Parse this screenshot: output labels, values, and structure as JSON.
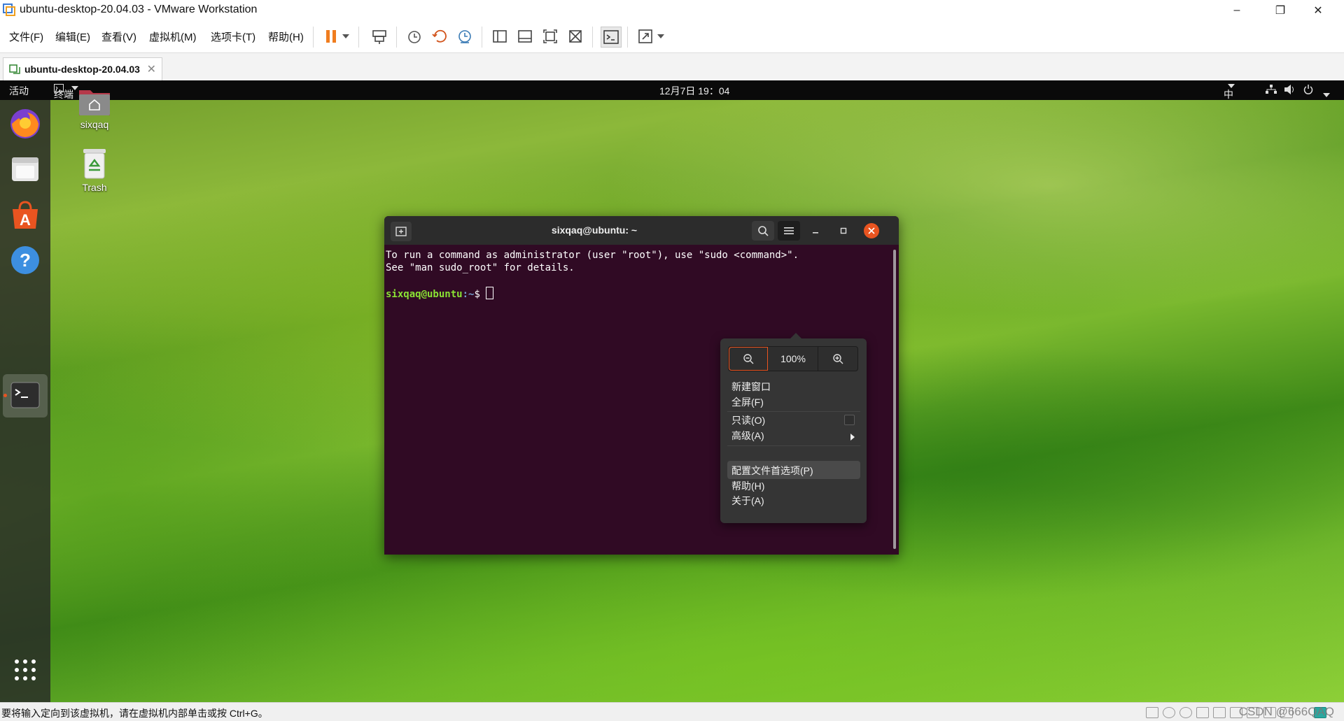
{
  "window": {
    "title": "ubuntu-desktop-20.04.03 - VMware Workstation",
    "minimize": "–",
    "restore": "❐",
    "close": "✕"
  },
  "menu": {
    "file": "文件(F)",
    "edit": "编辑(E)",
    "view": "查看(V)",
    "vm": "虚拟机(M)",
    "tabs": "选项卡(T)",
    "help": "帮助(H)"
  },
  "tab": {
    "label": "ubuntu-desktop-20.04.03",
    "close": "✕"
  },
  "guest": {
    "topbar": {
      "activities": "活动",
      "app_menu": "终端",
      "clock": "12月7日  19：04",
      "input_method": "中"
    },
    "desktop": {
      "home_label": "sixqaq",
      "trash_label": "Trash"
    }
  },
  "terminal": {
    "title": "sixqaq@ubuntu: ~",
    "line1": "To run a command as administrator (user \"root\"), use \"sudo <command>\".",
    "line2": "See \"man sudo_root\" for details.",
    "prompt_user": "sixqaq@ubuntu",
    "prompt_path": ":~",
    "prompt_symbol": "$ "
  },
  "popover": {
    "zoom_value": "100%",
    "new_window": "新建窗口",
    "fullscreen": "全屏(F)",
    "readonly": "只读(O)",
    "advanced": "高级(A)",
    "preferences": "配置文件首选项(P)",
    "help": "帮助(H)",
    "about": "关于(A)"
  },
  "statusbar": {
    "message": "要将输入定向到该虚拟机，请在虚拟机内部单击或按 Ctrl+G。",
    "watermark": "CSDN @666QAQ"
  },
  "colors": {
    "terminal_bg": "#300a24",
    "ubuntu_orange": "#e95420",
    "pause_orange": "#f07d1f"
  }
}
